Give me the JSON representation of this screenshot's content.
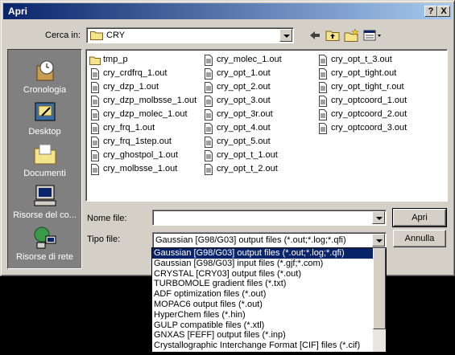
{
  "window": {
    "title": "Apri",
    "help_label": "?",
    "close_label": "X"
  },
  "lookin": {
    "label": "Cerca in:",
    "value": "CRY"
  },
  "places": [
    {
      "label": "Cronologia",
      "icon": "history-icon"
    },
    {
      "label": "Desktop",
      "icon": "desktop-icon"
    },
    {
      "label": "Documenti",
      "icon": "documents-icon"
    },
    {
      "label": "Risorse del co...",
      "icon": "my-computer-icon"
    },
    {
      "label": "Risorse di rete",
      "icon": "network-icon"
    }
  ],
  "files": {
    "col1": [
      "tmp_p",
      "cry_crdfrq_1.out",
      "cry_dzp_1.out",
      "cry_dzp_molbsse_1.out",
      "cry_dzp_molec_1.out",
      "cry_frq_1.out",
      "cry_frq_1step.out",
      "cry_ghostpol_1.out",
      "cry_molbsse_1.out"
    ],
    "col2": [
      "cry_molec_1.out",
      "cry_opt_1.out",
      "cry_opt_2.out",
      "cry_opt_3.out",
      "cry_opt_3r.out",
      "cry_opt_4.out",
      "cry_opt_5.out",
      "cry_opt_t_1.out",
      "cry_opt_t_2.out"
    ],
    "col3": [
      "cry_opt_t_3.out",
      "cry_opt_tight.out",
      "cry_opt_tight_r.out",
      "cry_optcoord_1.out",
      "cry_optcoord_2.out",
      "cry_optcoord_3.out"
    ]
  },
  "filename": {
    "label": "Nome file:",
    "value": ""
  },
  "filetype": {
    "label": "Tipo file:",
    "value": "Gaussian [G98/G03] output files (*.out;*.log;*.qfi)",
    "options": [
      "Gaussian [G98/G03] output files (*.out;*.log;*.qfi)",
      "Gaussian [G98/G03] input files (*.gjf;*.com)",
      "CRYSTAL [CRY03] output files (*.out)",
      "TURBOMOLE gradient files (*.txt)",
      "ADF optimization files (*.out)",
      "MOPAC6 output files  (*.out)",
      "HyperChem files (*.hin)",
      "GULP compatible files (*.xtl)",
      "GNXAS [FEFF] output files (*.inp)",
      "Crystallographic Interchange Format [CIF] files (*.cif)"
    ]
  },
  "buttons": {
    "open": "Apri",
    "cancel": "Annulla"
  }
}
